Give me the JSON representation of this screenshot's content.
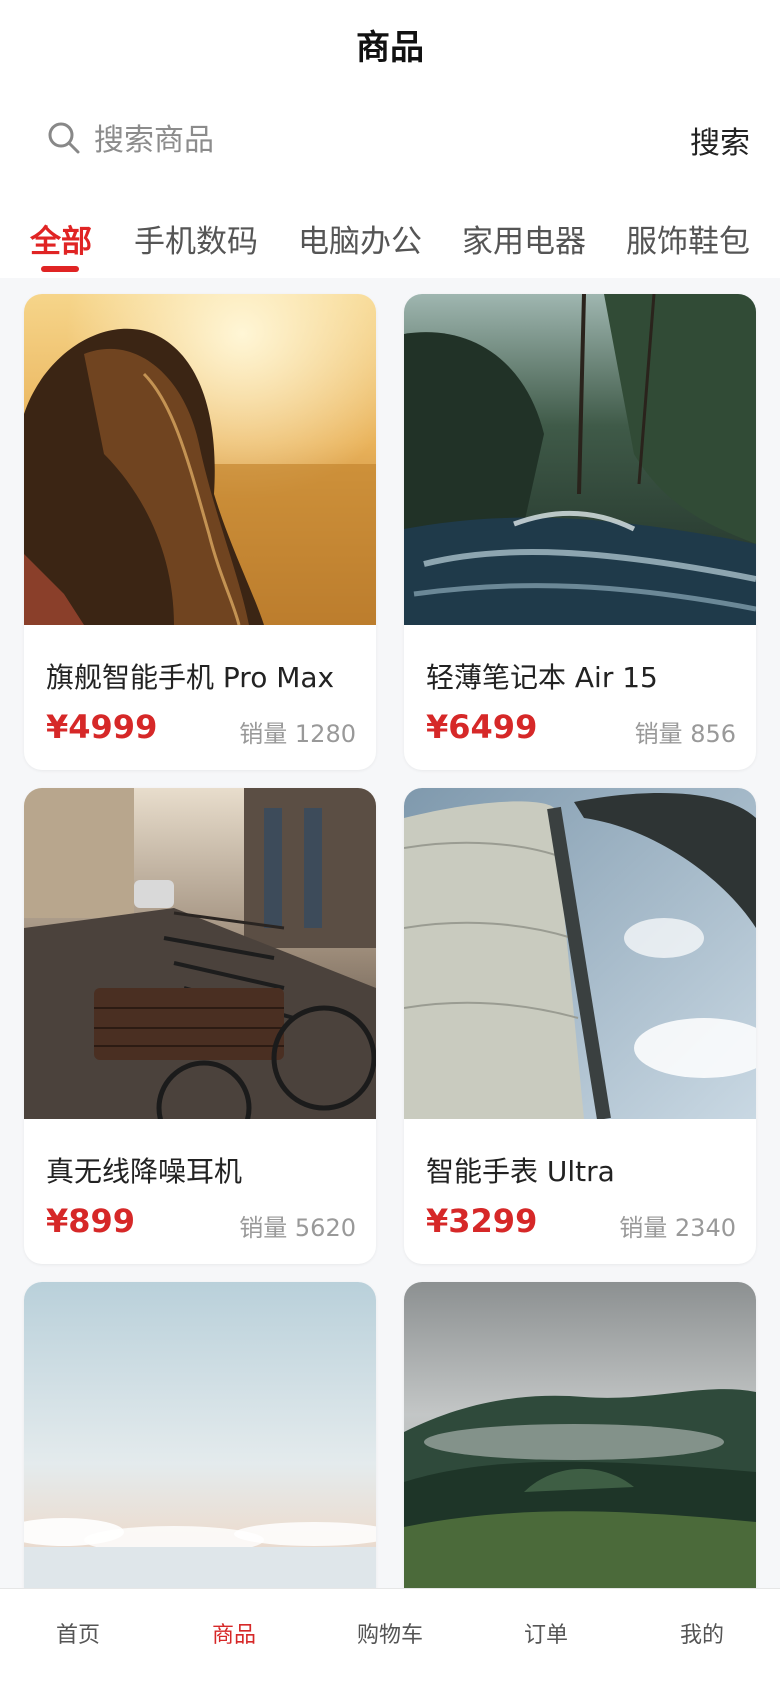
{
  "header": {
    "title": "商品"
  },
  "search": {
    "placeholder": "搜索商品",
    "button_label": "搜索"
  },
  "tabs": [
    {
      "label": "全部",
      "active": true
    },
    {
      "label": "手机数码",
      "active": false
    },
    {
      "label": "电脑办公",
      "active": false
    },
    {
      "label": "家用电器",
      "active": false
    },
    {
      "label": "服饰鞋包",
      "active": false
    }
  ],
  "products": [
    {
      "name": "旗舰智能手机 Pro Max",
      "price": "¥4999",
      "sales": "销量 1280",
      "image": "sunset-hair-photo"
    },
    {
      "name": "轻薄笔记本 Air 15",
      "price": "¥6499",
      "sales": "销量 856",
      "image": "forest-river-photo"
    },
    {
      "name": "真无线降噪耳机",
      "price": "¥899",
      "sales": "销量 5620",
      "image": "street-bicycle-photo"
    },
    {
      "name": "智能手表 Ultra",
      "price": "¥3299",
      "sales": "销量 2340",
      "image": "sail-sky-photo"
    },
    {
      "name": "",
      "price": "",
      "sales": "",
      "image": "sky-clouds-photo"
    },
    {
      "name": "",
      "price": "",
      "sales": "",
      "image": "misty-forest-photo"
    }
  ],
  "bottom_nav": [
    {
      "label": "首页",
      "active": false
    },
    {
      "label": "商品",
      "active": true
    },
    {
      "label": "购物车",
      "active": false
    },
    {
      "label": "订单",
      "active": false
    },
    {
      "label": "我的",
      "active": false
    }
  ],
  "colors": {
    "accent": "#d62828",
    "background": "#f6f7f9"
  }
}
